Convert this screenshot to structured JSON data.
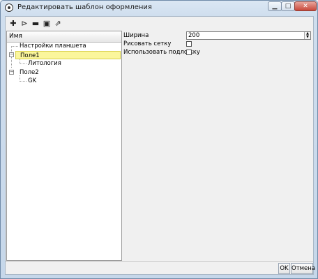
{
  "window": {
    "title": "Редактировать шаблон оформления"
  },
  "toolbar": {
    "buttons": [
      {
        "name": "add-icon",
        "glyph": "✚"
      },
      {
        "name": "add-child-icon",
        "glyph": "⊳"
      },
      {
        "name": "remove-icon",
        "glyph": "▬"
      },
      {
        "name": "save-icon",
        "glyph": "▣"
      },
      {
        "name": "open-icon",
        "glyph": "⇗"
      }
    ]
  },
  "tree": {
    "header": "Имя",
    "items": [
      {
        "label": "Настройки планшета"
      },
      {
        "label": "Поле1"
      },
      {
        "label": "Литология"
      },
      {
        "label": "Поле2"
      },
      {
        "label": "GK"
      }
    ]
  },
  "properties": {
    "width_label": "Ширина",
    "width_value": "200",
    "grid_label": "Рисовать сетку",
    "backing_label": "Использовать подложку"
  },
  "buttons": {
    "ok": "OK",
    "cancel": "Отмена"
  }
}
